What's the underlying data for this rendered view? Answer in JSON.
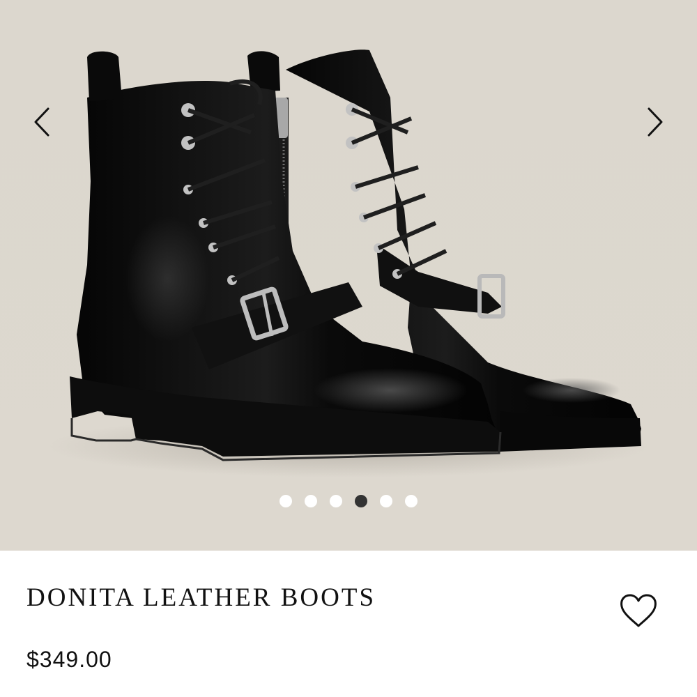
{
  "gallery": {
    "image_alt": "Black leather lace-up combat boots with silver buckles",
    "prev_icon": "chevron-left-icon",
    "next_icon": "chevron-right-icon",
    "dot_count": 6,
    "active_index": 3,
    "colors": {
      "background": "#ddd8cf",
      "boot": "#0c0c0c",
      "hardware": "#b8b8b8",
      "dot": "#ffffff",
      "dot_active": "#333333"
    }
  },
  "product": {
    "name": "DONITA LEATHER BOOTS",
    "price": "$349.00",
    "wishlist_icon": "heart-outline-icon"
  }
}
